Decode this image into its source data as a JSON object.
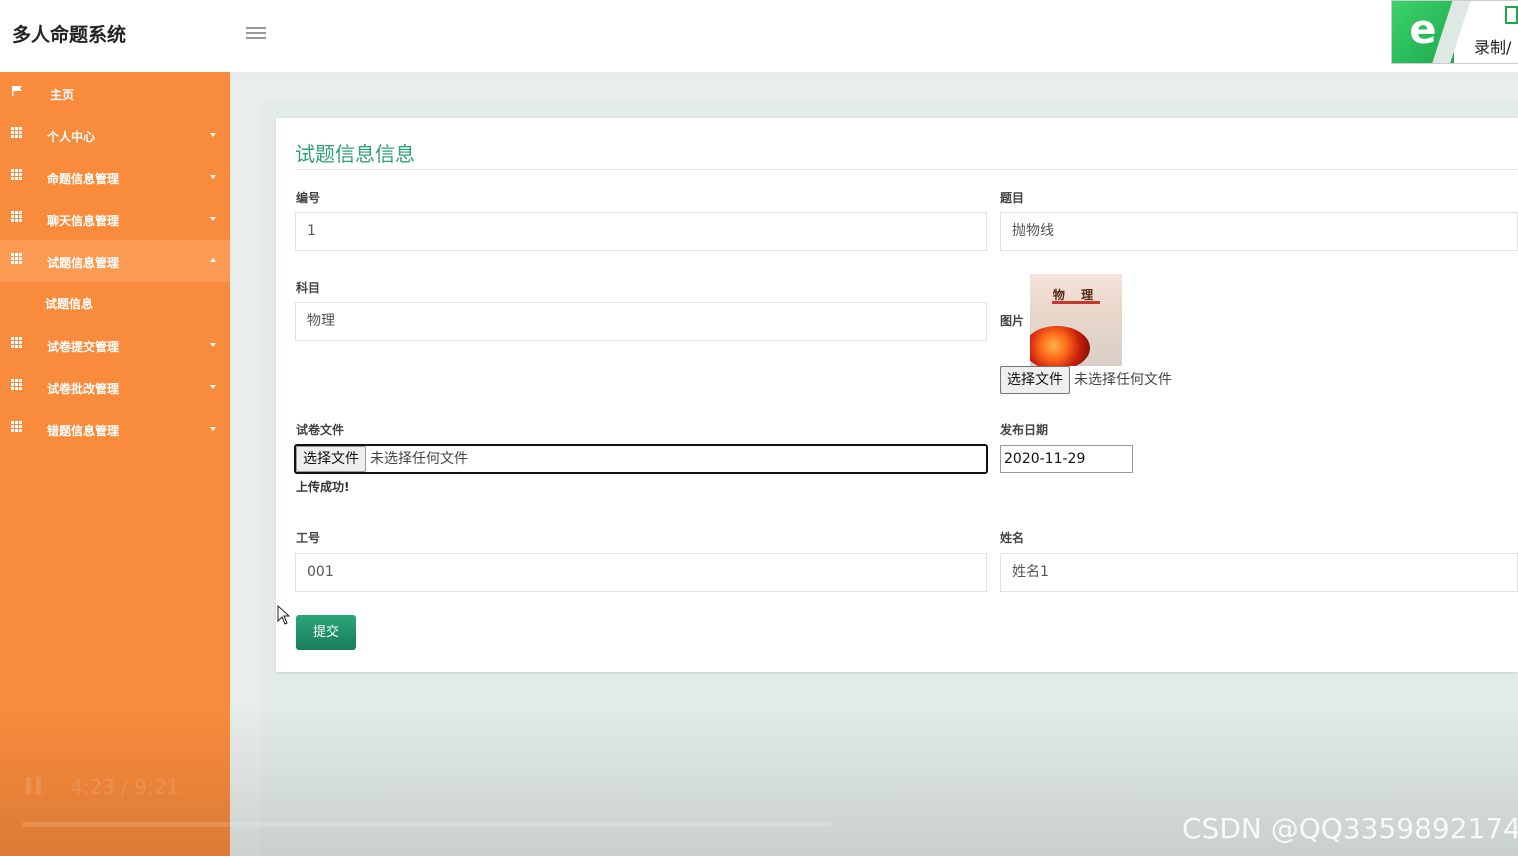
{
  "app": {
    "title": "多人命题系统"
  },
  "recorder": {
    "logo": "e",
    "label": "录制/"
  },
  "sidebar": {
    "items": [
      {
        "label": "主页",
        "icon": "flag-icon"
      },
      {
        "label": "个人中心",
        "icon": "grid-icon"
      },
      {
        "label": "命题信息管理",
        "icon": "grid-icon"
      },
      {
        "label": "聊天信息管理",
        "icon": "grid-icon"
      },
      {
        "label": "试题信息管理",
        "icon": "grid-icon",
        "expanded": true
      },
      {
        "label": "试题信息",
        "icon": ""
      },
      {
        "label": "试卷提交管理",
        "icon": "grid-icon"
      },
      {
        "label": "试卷批改管理",
        "icon": "grid-icon"
      },
      {
        "label": "错题信息管理",
        "icon": "grid-icon"
      }
    ]
  },
  "form": {
    "title": "试题信息信息",
    "number": {
      "label": "编号",
      "value": "1"
    },
    "question": {
      "label": "题目",
      "value": "抛物线"
    },
    "subject": {
      "label": "科目",
      "value": "物理"
    },
    "image": {
      "label": "图片",
      "book_title": "物 理",
      "file_button": "选择文件",
      "file_text": "未选择任何文件"
    },
    "paper_file": {
      "label": "试卷文件",
      "file_button": "选择文件",
      "file_text": "未选择任何文件",
      "message": "上传成功!"
    },
    "publish_date": {
      "label": "发布日期",
      "value": "2020-11-29"
    },
    "staff_id": {
      "label": "工号",
      "value": "001"
    },
    "name": {
      "label": "姓名",
      "value": "姓名1"
    },
    "submit_label": "提交"
  },
  "video": {
    "time": "4:23 / 9:21"
  },
  "watermark": "CSDN @QQ3359892174",
  "colors": {
    "sidebar": "#f98c3c",
    "accent": "#2f9e7a",
    "button": "#1a7d5a"
  }
}
